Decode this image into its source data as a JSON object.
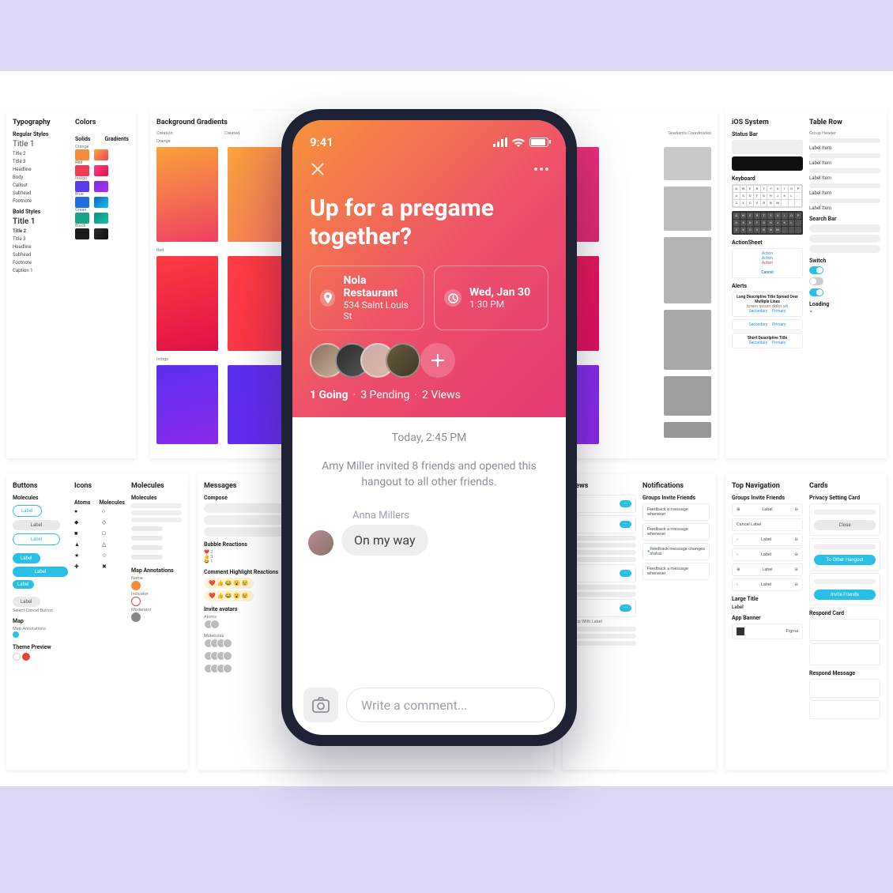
{
  "phone": {
    "status_time": "9:41",
    "title": "Up for a pregame together?",
    "place": {
      "name": "Nola Restaurant",
      "addr": "534 Saint Louis St"
    },
    "when": {
      "date": "Wed, Jan 30",
      "time": "1:30 PM"
    },
    "stats": {
      "going": "1 Going",
      "pending": "3 Pending",
      "views": "2 Views"
    },
    "timestamp": "Today, 2:45 PM",
    "note": "Amy Miller invited 8 friends and opened this hangout to all other friends.",
    "msg": {
      "name": "Anna Millers",
      "text": "On my way"
    },
    "composer_placeholder": "Write a comment..."
  },
  "typo": {
    "h": "Typography",
    "sub1": "Regular Styles",
    "items1": [
      "Title 1",
      "Title 2",
      "Title 3",
      "Headline",
      "Body",
      "Callout",
      "Subhead",
      "Footnote"
    ],
    "sub2": "Bold Styles",
    "items2": [
      "Title 1",
      "Title 2",
      "Title 3",
      "Headline",
      "Subhead",
      "Footnote",
      "Caption 1"
    ]
  },
  "colors": {
    "h": "Colors",
    "solids_h": "Solids",
    "grad_h": "Gradients",
    "rows": [
      {
        "name": "Orange",
        "s": "#f58b3b",
        "g": [
          "#fca43a",
          "#f3425c"
        ]
      },
      {
        "name": "Red",
        "s": "#ef3b52",
        "g": [
          "#ff3e7f",
          "#e01047"
        ]
      },
      {
        "name": "Indigo",
        "s": "#5b3bef",
        "g": [
          "#7a2ff0",
          "#b22ae8"
        ]
      },
      {
        "name": "Blue",
        "s": "#1f6fe0",
        "g": [
          "#0b63d6",
          "#14c4d8"
        ]
      },
      {
        "name": "Green",
        "s": "#14a58a",
        "g": [
          "#0f8e86",
          "#14c4a0"
        ]
      },
      {
        "name": "Black",
        "s": "#1b1b1d",
        "g": [
          "#2b2b30",
          "#0f0f12"
        ]
      }
    ]
  },
  "grad": {
    "h": "Background Gradients",
    "sub_creation": "Creation",
    "sub_created": "Created",
    "sub_coords": "Gradients Coordinates",
    "names": [
      "Orange",
      "Red",
      "Indigo"
    ]
  },
  "ios": {
    "h": "iOS System",
    "statusbar": "Status Bar",
    "keyboard": "Keyboard",
    "actionsheet": "ActionSheet",
    "as_items": [
      "Action",
      "Action",
      "Action",
      "Cancel"
    ],
    "alerts": "Alerts",
    "alert1_title": "Long Descriptive Title Spread Over Multiple Lines",
    "alert_btns": [
      "Secondary",
      "Primary"
    ],
    "alert2_title": "Short Descriptive Title",
    "tablerow": "Table Row",
    "tr_items": [
      "Group Header",
      "Label Item",
      "Label Item",
      "Label Item",
      "Label Item",
      "Label Item"
    ],
    "searchbar": "Search Bar",
    "switch": "Switch",
    "loading": "Loading"
  },
  "buttons": {
    "h": "Buttons",
    "sub": "Molecules",
    "labels": [
      "Label",
      "Label",
      "Label",
      "Label",
      "Label",
      "Label",
      "Label",
      "Select Cancel Button"
    ],
    "map_h": "Map",
    "mapnote": "Map Annotations",
    "theme_h": "Theme Preview"
  },
  "icons": {
    "h": "Icons",
    "atoms": "Atoms",
    "mol": "Molecules"
  },
  "molecules": {
    "h": "Molecules",
    "sub": "Molecules",
    "map_h": "Map Annotations",
    "name": "Name",
    "indicator": "Indicator",
    "mod": "Moderator"
  },
  "messages": {
    "h": "Messages",
    "compose": "Compose",
    "reactions": "Bubble Reactions",
    "highlight": "Comment Highlight Reactions",
    "invite": "Invite avatars",
    "atoms": "Atoms",
    "mol": "Molecules"
  },
  "views": {
    "h": "Views"
  },
  "notifications": {
    "h": "Notifications",
    "sub": "Groups Invite Friends",
    "items": [
      "Feedback a message whenever",
      "Feedback a message whenever",
      "Feedback message changes status",
      "Feedback a message whenever"
    ]
  },
  "topnav": {
    "h": "Top Navigation",
    "sub": "Groups Invite Friends",
    "rows": [
      "Label",
      "Cancel   Label",
      "Label",
      "Label",
      "Label",
      "Label"
    ],
    "large": "Large Title",
    "large_v": "Label",
    "banner": "App Banner",
    "banner_v": "Figma"
  },
  "cards": {
    "h": "Cards",
    "privacy": "Privacy Setting Card",
    "btns": [
      "Close",
      "To Other Hangout",
      "Invite Friends"
    ],
    "respond": "Respond Card",
    "respond_msg": "Respond Message"
  }
}
